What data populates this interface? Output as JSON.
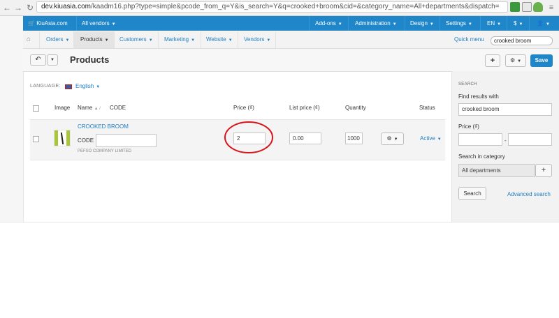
{
  "browser": {
    "url_domain": "dev.kiuasia.com",
    "url_rest": "/kaadm16.php?type=simple&pcode_from_q=Y&is_search=Y&q=crooked+broom&cid=&category_name=All+departments&dispatch="
  },
  "topbar": {
    "store": "KiuAsia.com",
    "vendors": "All vendors",
    "addons": "Add-ons",
    "administration": "Administration",
    "design": "Design",
    "settings": "Settings",
    "language": "EN",
    "currency": "$"
  },
  "subnav": {
    "items": [
      {
        "label": "Orders"
      },
      {
        "label": "Products"
      },
      {
        "label": "Customers"
      },
      {
        "label": "Marketing"
      },
      {
        "label": "Website"
      },
      {
        "label": "Vendors"
      }
    ],
    "quick_menu": "Quick menu",
    "search_value": "crooked broom"
  },
  "page": {
    "title": "Products",
    "save": "Save",
    "add": "+"
  },
  "language": {
    "label": "LANGUAGE:",
    "value": "English"
  },
  "table": {
    "headers": {
      "image": "Image",
      "name": "Name",
      "sort": "▲ /",
      "code": "CODE",
      "price": "Price (₫)",
      "list_price": "List price (₫)",
      "quantity": "Quantity",
      "status": "Status"
    },
    "row": {
      "name": "CROOKED BROOM",
      "code_label": "CODE",
      "code_value": "",
      "vendor": "PEFSO COMPANY LIMITED",
      "price": "2",
      "list_price": "0.00",
      "quantity": "1000",
      "status": "Active"
    }
  },
  "sidebar": {
    "heading": "SEARCH",
    "find_label": "Find results with",
    "find_value": "crooked broom",
    "price_label": "Price (₫)",
    "price_dash": "-",
    "category_label": "Search in category",
    "category_value": "All departments",
    "search_button": "Search",
    "advanced_link": "Advanced search"
  },
  "colors": {
    "topbar": "#1f87c9",
    "link": "#1f7ec2",
    "save": "#1f87c9",
    "annotation": "#d9141b"
  }
}
